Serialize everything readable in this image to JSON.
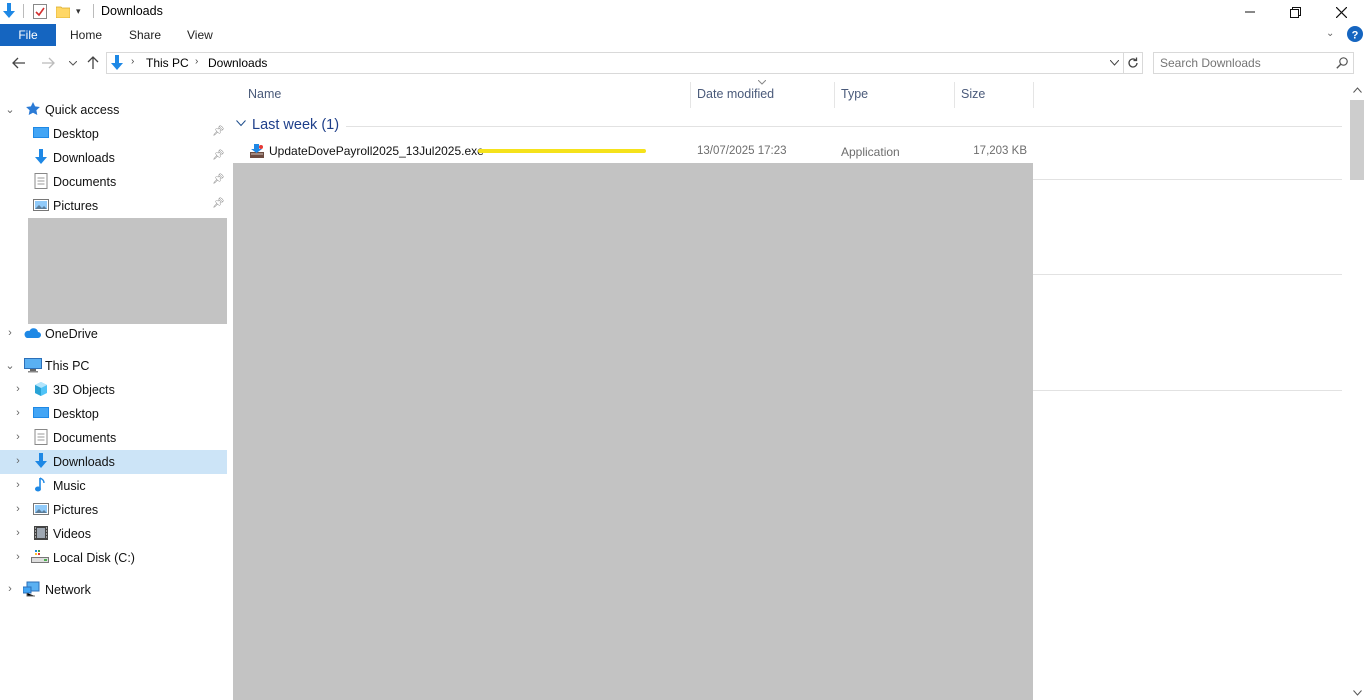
{
  "window": {
    "title": "Downloads"
  },
  "ribbon": {
    "file": "File",
    "tabs": [
      "Home",
      "Share",
      "View"
    ]
  },
  "address": {
    "crumbs": [
      "This PC",
      "Downloads"
    ]
  },
  "search": {
    "placeholder": "Search Downloads"
  },
  "nav": {
    "quick_access": "Quick access",
    "quick_items": [
      "Desktop",
      "Downloads",
      "Documents",
      "Pictures"
    ],
    "onedrive": "OneDrive",
    "this_pc": "This PC",
    "pc_items": [
      "3D Objects",
      "Desktop",
      "Documents",
      "Downloads",
      "Music",
      "Pictures",
      "Videos",
      "Local Disk (C:)"
    ],
    "network": "Network"
  },
  "columns": {
    "name": "Name",
    "date": "Date modified",
    "type": "Type",
    "size": "Size"
  },
  "group": {
    "label": "Last week (1)"
  },
  "files": [
    {
      "name": "UpdateDovePayroll2025_13Jul2025.exe",
      "date": "13/07/2025 17:23",
      "type": "Application",
      "size": "17,203 KB"
    }
  ],
  "colors": {
    "accent": "#1565c0",
    "selection": "#cce4f7",
    "highlight": "#f5e21b",
    "redaction": "#c3c3c3"
  }
}
